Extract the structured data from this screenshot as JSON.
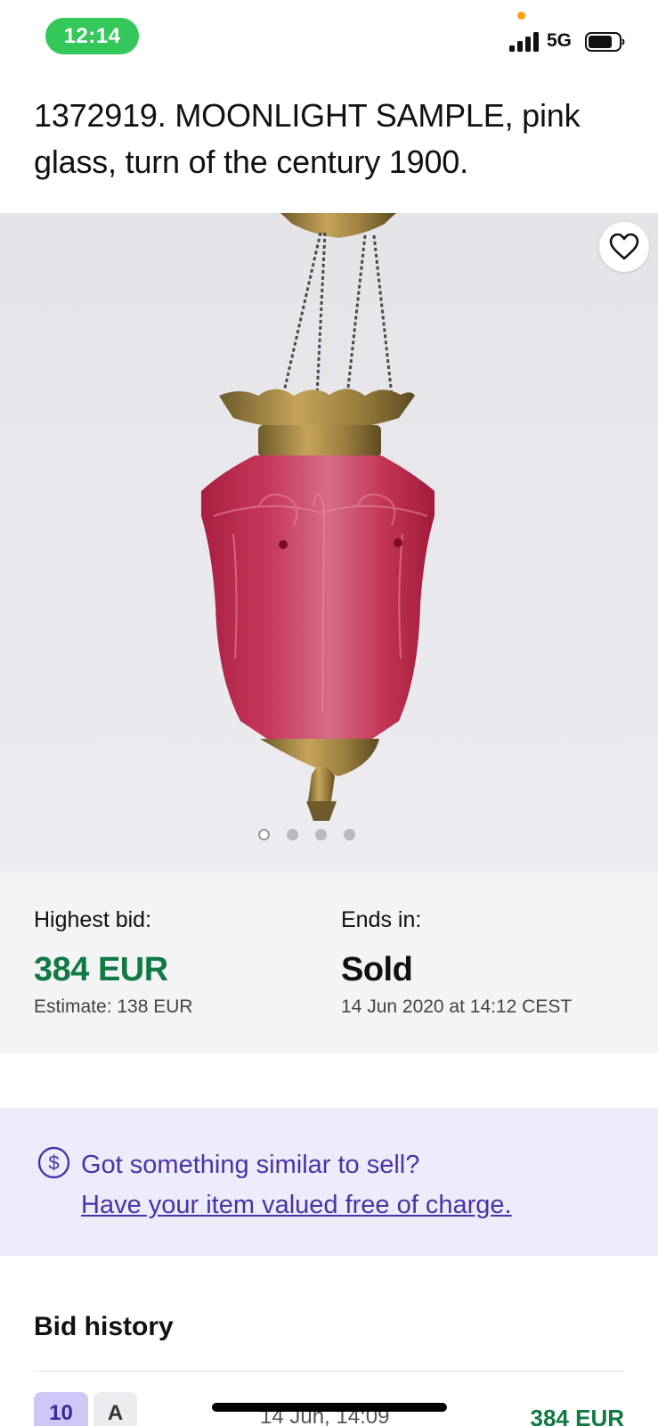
{
  "status_bar": {
    "time": "12:14",
    "network": "5G",
    "icons": [
      "signal-icon",
      "battery-icon"
    ]
  },
  "lot": {
    "title": "1372919. MOONLIGHT SAMPLE, pink glass, turn of the century 1900.",
    "image_alt": "pink glass hanging lamp with brass fittings",
    "image_count": 4,
    "active_image_index": 0,
    "favorite_icon": "heart-icon"
  },
  "bid_info": {
    "highest_bid_label": "Highest bid:",
    "highest_bid_value": "384 EUR",
    "estimate": "Estimate: 138 EUR",
    "ends_in_label": "Ends in:",
    "ends_in_value": "Sold",
    "end_date": "14 Jun 2020 at 14:12 CEST"
  },
  "promo": {
    "icon": "dollar-circle-icon",
    "text": "Got something similar to sell?",
    "link": "Have your item valued free of charge."
  },
  "bid_history": {
    "title": "Bid history",
    "rows": [
      {
        "number": "10",
        "bidder": "A",
        "date": "14 Jun, 14:09",
        "amount": "384 EUR"
      }
    ]
  },
  "colors": {
    "accent_green": "#117a43",
    "promo_purple": "#4a33a8",
    "status_green": "#34c759"
  }
}
